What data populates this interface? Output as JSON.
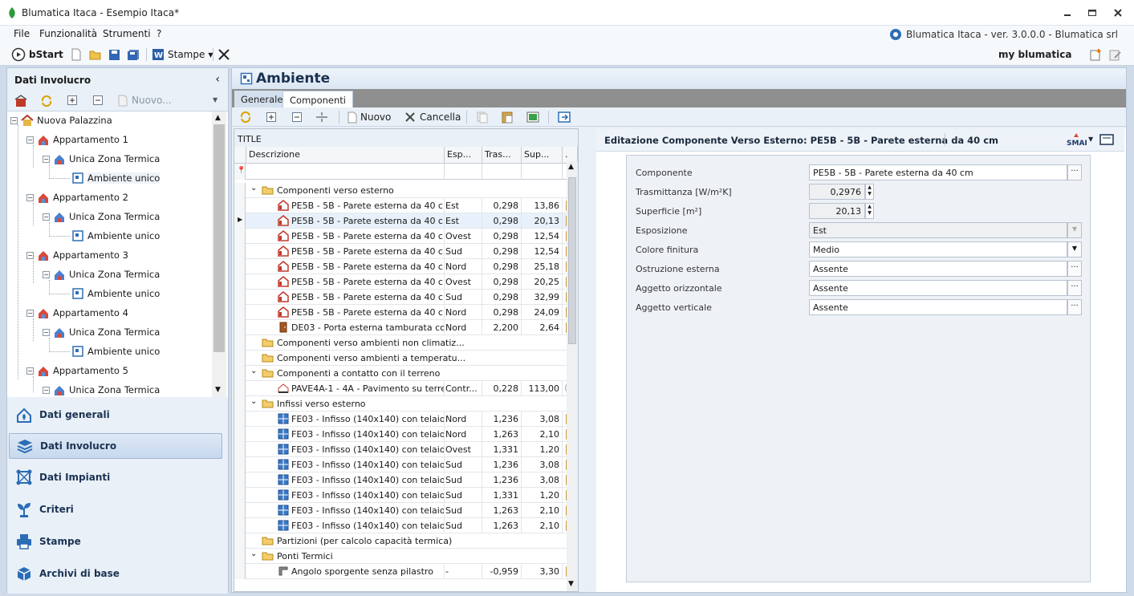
{
  "window": {
    "title": "Blumatica Itaca - Esempio Itaca*",
    "version_text": "Blumatica Itaca - ver. 3.0.0.0 - Blumatica srl",
    "min_icon": "minimize-icon",
    "max_icon": "maximize-icon",
    "close_icon": "close-icon"
  },
  "menu": {
    "items": [
      "File",
      "Funzionalità",
      "Strumenti",
      "?"
    ]
  },
  "toolbar": {
    "bstart": "bStart",
    "stampe": "Stampe",
    "myblumatica": "my blumatica"
  },
  "left_panel": {
    "title": "Dati Involucro",
    "nuovo": "Nuovo...",
    "tree": [
      {
        "label": "Nuova Palazzina",
        "level": 0
      },
      {
        "label": "Appartamento 1",
        "level": 1
      },
      {
        "label": "Unica Zona Termica",
        "level": 2
      },
      {
        "label": "Ambiente unico",
        "level": 3
      },
      {
        "label": "Appartamento 2",
        "level": 1
      },
      {
        "label": "Unica Zona Termica",
        "level": 2
      },
      {
        "label": "Ambiente unico",
        "level": 3
      },
      {
        "label": "Appartamento 3",
        "level": 1
      },
      {
        "label": "Unica Zona Termica",
        "level": 2
      },
      {
        "label": "Ambiente unico",
        "level": 3
      },
      {
        "label": "Appartamento 4",
        "level": 1
      },
      {
        "label": "Unica Zona Termica",
        "level": 2
      },
      {
        "label": "Ambiente unico",
        "level": 3
      },
      {
        "label": "Appartamento 5",
        "level": 1
      },
      {
        "label": "Unica Zona Termica",
        "level": 2
      }
    ],
    "nav": [
      "Dati generali",
      "Dati Involucro",
      "Dati Impianti",
      "Criteri",
      "Stampe",
      "Archivi di base"
    ],
    "nav_active": "Dati Involucro"
  },
  "main": {
    "title": "Ambiente",
    "tabs": [
      "Generale",
      "Componenti"
    ],
    "active_tab": "Componenti",
    "tools": {
      "nuovo": "Nuovo",
      "cancella": "Cancella"
    },
    "grid": {
      "title": "TITLE",
      "columns": [
        "Descrizione",
        "Esp...",
        "Tras...",
        "Sup...",
        "."
      ],
      "rows": [
        {
          "type": "group",
          "label": "Componenti verso esterno",
          "expanded": true
        },
        {
          "type": "item",
          "icon": "wall-icon",
          "desc": "PE5B - 5B - Parete esterna da 40 cm",
          "esp": "Est",
          "tras": "0,298",
          "sup": "13,86",
          "mark": "lock"
        },
        {
          "type": "item",
          "icon": "wall-icon",
          "desc": "PE5B - 5B - Parete esterna da 40 cm",
          "esp": "Est",
          "tras": "0,298",
          "sup": "20,13",
          "mark": "lock",
          "selected": true
        },
        {
          "type": "item",
          "icon": "wall-icon",
          "desc": "PE5B - 5B - Parete esterna da 40 cm",
          "esp": "Ovest",
          "tras": "0,298",
          "sup": "12,54",
          "mark": "lock"
        },
        {
          "type": "item",
          "icon": "wall-icon",
          "desc": "PE5B - 5B - Parete esterna da 40 cm",
          "esp": "Sud",
          "tras": "0,298",
          "sup": "12,54",
          "mark": "lock"
        },
        {
          "type": "item",
          "icon": "wall-icon",
          "desc": "PE5B - 5B - Parete esterna da 40 cm",
          "esp": "Nord",
          "tras": "0,298",
          "sup": "25,18",
          "mark": "lock"
        },
        {
          "type": "item",
          "icon": "wall-icon",
          "desc": "PE5B - 5B - Parete esterna da 40 cm",
          "esp": "Ovest",
          "tras": "0,298",
          "sup": "20,25",
          "mark": "lock"
        },
        {
          "type": "item",
          "icon": "wall-icon",
          "desc": "PE5B - 5B - Parete esterna da 40 cm",
          "esp": "Sud",
          "tras": "0,298",
          "sup": "32,99",
          "mark": "lock"
        },
        {
          "type": "item",
          "icon": "wall-icon",
          "desc": "PE5B - 5B - Parete esterna da 40 cm",
          "esp": "Nord",
          "tras": "0,298",
          "sup": "24,09",
          "mark": "lock"
        },
        {
          "type": "item",
          "icon": "door-icon",
          "desc": "DE03 - Porta esterna tamburata con...",
          "esp": "Nord",
          "tras": "2,200",
          "sup": "2,64",
          "mark": "lock"
        },
        {
          "type": "group",
          "label": "Componenti verso ambienti non climatiz...",
          "expanded": false
        },
        {
          "type": "group",
          "label": "Componenti verso ambienti a temperatu...",
          "expanded": false
        },
        {
          "type": "group",
          "label": "Componenti a contatto con il terreno",
          "expanded": true
        },
        {
          "type": "item",
          "icon": "floor-icon",
          "desc": "PAVE4A-1 - 4A - Pavimento su terre...",
          "esp": "Contr...",
          "tras": "0,228",
          "sup": "113,00",
          "mark": "circle"
        },
        {
          "type": "group",
          "label": "Infissi verso esterno",
          "expanded": true
        },
        {
          "type": "item",
          "icon": "window-icon",
          "desc": "FE03 - Infisso (140x140) con telaio l...",
          "esp": "Nord",
          "tras": "1,236",
          "sup": "3,08",
          "mark": "lock"
        },
        {
          "type": "item",
          "icon": "window-icon",
          "desc": "FE03 - Infisso (140x140) con telaio l...",
          "esp": "Nord",
          "tras": "1,263",
          "sup": "2,10",
          "mark": "lock"
        },
        {
          "type": "item",
          "icon": "window-icon",
          "desc": "FE03 - Infisso (140x140) con telaio l...",
          "esp": "Ovest",
          "tras": "1,331",
          "sup": "1,20",
          "mark": "lock"
        },
        {
          "type": "item",
          "icon": "window-icon",
          "desc": "FE03 - Infisso (140x140) con telaio l...",
          "esp": "Sud",
          "tras": "1,236",
          "sup": "3,08",
          "mark": "lock"
        },
        {
          "type": "item",
          "icon": "window-icon",
          "desc": "FE03 - Infisso (140x140) con telaio l...",
          "esp": "Sud",
          "tras": "1,236",
          "sup": "3,08",
          "mark": "lock"
        },
        {
          "type": "item",
          "icon": "window-icon",
          "desc": "FE03 - Infisso (140x140) con telaio l...",
          "esp": "Sud",
          "tras": "1,331",
          "sup": "1,20",
          "mark": "lock"
        },
        {
          "type": "item",
          "icon": "window-icon",
          "desc": "FE03 - Infisso (140x140) con telaio l...",
          "esp": "Sud",
          "tras": "1,263",
          "sup": "2,10",
          "mark": "lock"
        },
        {
          "type": "item",
          "icon": "window-icon",
          "desc": "FE03 - Infisso (140x140) con telaio l...",
          "esp": "Sud",
          "tras": "1,263",
          "sup": "2,10",
          "mark": "lock"
        },
        {
          "type": "group",
          "label": "Partizioni (per calcolo capacità termica)",
          "expanded": false
        },
        {
          "type": "group",
          "label": "Ponti Termici",
          "expanded": true
        },
        {
          "type": "item",
          "icon": "corner-icon",
          "desc": "Angolo sporgente senza pilastro",
          "esp": "-",
          "tras": "-0,959",
          "sup": "3,30",
          "mark": "lock"
        }
      ]
    },
    "editor": {
      "title": "Editazione Componente Verso Esterno: PE5B - 5B - Parete esterna da 40 cm",
      "fields": [
        {
          "label": "Componente",
          "value": "PE5B - 5B - Parete esterna da 40 cm",
          "kind": "dots"
        },
        {
          "label": "Trasmittanza [W/m²K]",
          "value": "0,2976",
          "kind": "spin"
        },
        {
          "label": "Superficie [m²]",
          "value": "20,13",
          "kind": "spin"
        },
        {
          "label": "Esposizione",
          "value": "Est",
          "kind": "combo-disabled"
        },
        {
          "label": "Colore finitura",
          "value": "Medio",
          "kind": "combo"
        },
        {
          "label": "Ostruzione esterna",
          "value": "Assente",
          "kind": "dots"
        },
        {
          "label": "Aggetto orizzontale",
          "value": "Assente",
          "kind": "dots"
        },
        {
          "label": "Aggetto verticale",
          "value": "Assente",
          "kind": "dots"
        }
      ]
    }
  }
}
